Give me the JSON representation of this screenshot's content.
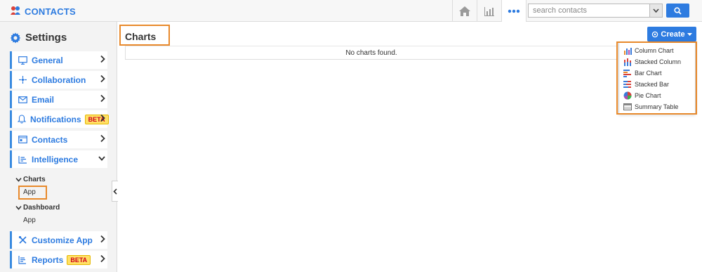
{
  "app": {
    "brand": "CONTACTS"
  },
  "search": {
    "placeholder": "search contacts"
  },
  "sidebar": {
    "title": "Settings",
    "items": [
      {
        "label": "General",
        "icon": "monitor-icon",
        "expanded": false
      },
      {
        "label": "Collaboration",
        "icon": "network-icon",
        "expanded": false
      },
      {
        "label": "Email",
        "icon": "envelope-icon",
        "expanded": false
      },
      {
        "label": "Notifications",
        "icon": "bell-icon",
        "badge": "BETA",
        "expanded": false
      },
      {
        "label": "Contacts",
        "icon": "contact-card-icon",
        "expanded": false
      },
      {
        "label": "Intelligence",
        "icon": "list-icon",
        "expanded": true
      },
      {
        "label": "Customize App",
        "icon": "tools-icon",
        "expanded": false
      },
      {
        "label": "Reports",
        "icon": "report-icon",
        "badge": "BETA",
        "expanded": false
      }
    ],
    "subsections": [
      {
        "heading": "Charts",
        "item": "App",
        "selected": true
      },
      {
        "heading": "Dashboard",
        "item": "App",
        "selected": false
      }
    ]
  },
  "main": {
    "title": "Charts",
    "create_label": "Create",
    "empty_message": "No charts found.",
    "create_menu": [
      {
        "label": "Column Chart",
        "icon": "column-chart-icon"
      },
      {
        "label": "Stacked Column",
        "icon": "stacked-column-icon"
      },
      {
        "label": "Bar Chart",
        "icon": "bar-chart-icon"
      },
      {
        "label": "Stacked Bar",
        "icon": "stacked-bar-icon"
      },
      {
        "label": "Pie Chart",
        "icon": "pie-chart-icon"
      },
      {
        "label": "Summary Table",
        "icon": "summary-table-icon"
      }
    ]
  },
  "colors": {
    "accent": "#2d7be0",
    "highlight": "#e8892b",
    "badge_bg": "#ffe066",
    "badge_text": "#d0021b"
  }
}
